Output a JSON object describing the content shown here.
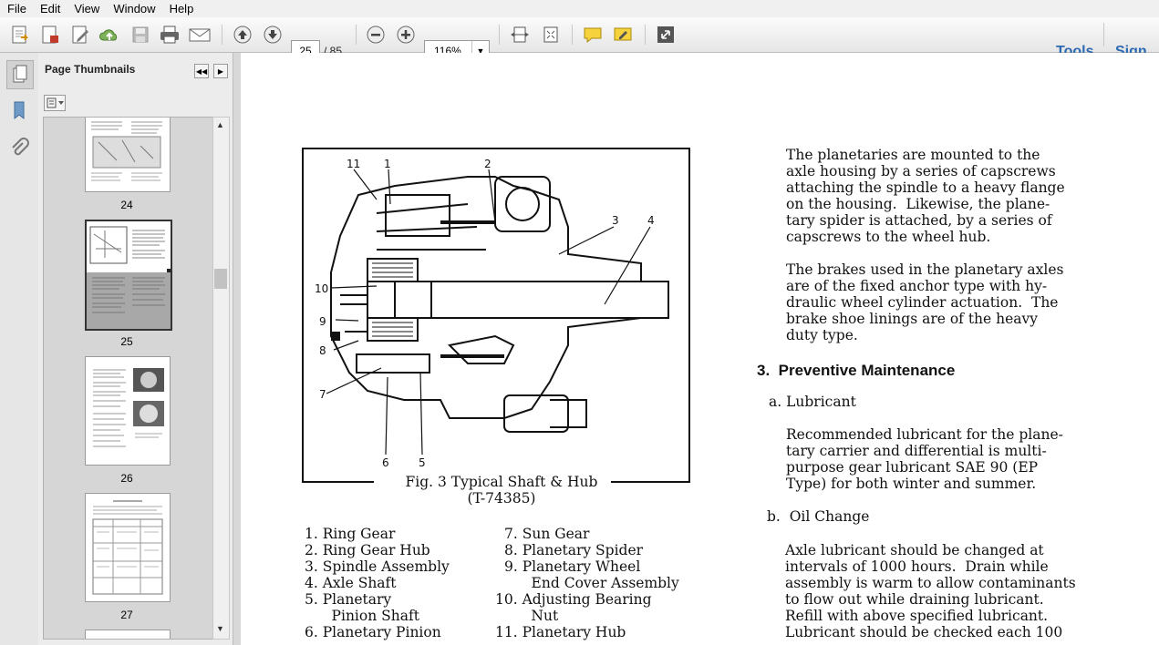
{
  "menu": [
    "File",
    "Edit",
    "View",
    "Window",
    "Help"
  ],
  "toolbar": {
    "page_current": "25",
    "page_total": "/ 85",
    "zoom": "116%",
    "tools_label": "Tools",
    "sign_label": "Sign"
  },
  "nav_panel": {
    "title": "Page Thumbnails",
    "pages": [
      "24",
      "25",
      "26",
      "27"
    ]
  },
  "figure": {
    "caption_line1": "Fig. 3 Typical Shaft & Hub",
    "caption_line2": "(T-74385)",
    "callouts": [
      "11",
      "1",
      "2",
      "3",
      "4",
      "10",
      "9",
      "8",
      "7",
      "6",
      "5"
    ]
  },
  "legend": {
    "left": [
      "1.  Ring Gear",
      "2.  Ring Gear Hub",
      "3.  Spindle Assembly",
      "4.  Axle Shaft",
      "5.  Planetary",
      "      Pinion Shaft",
      "6.  Planetary Pinion"
    ],
    "right": [
      "7.  Sun Gear",
      "8.  Planetary Spider",
      "9.  Planetary Wheel",
      "      End Cover Assembly",
      "10.  Adjusting Bearing",
      "        Nut",
      "11.  Planetary Hub"
    ]
  },
  "body": {
    "para1": [
      "The planetaries are mounted to the",
      "axle housing by a series of capscrews",
      "attaching the spindle to a heavy flange",
      "on the housing.  Likewise, the plane-",
      "tary spider is attached, by a series of",
      "capscrews to the wheel hub."
    ],
    "para2": [
      "The brakes used in the planetary axles",
      "are of the fixed anchor type with hy-",
      "draulic wheel cylinder actuation.  The",
      "brake shoe linings are of the heavy",
      "duty type."
    ],
    "section_heading": "3.  Preventive Maintenance",
    "sub_a": "a. Lubricant",
    "para3": [
      "Recommended lubricant for the plane-",
      "tary carrier and differential is multi-",
      "purpose gear lubricant SAE 90 (EP",
      "Type) for both winter and summer."
    ],
    "sub_b": "b.  Oil Change",
    "para4": [
      "Axle lubricant should be changed at",
      "intervals of 1000 hours.  Drain while",
      "assembly is warm to allow contaminants",
      "to flow out while draining lubricant.",
      "Refill with above specified lubricant.",
      "Lubricant should be checked each 100"
    ]
  }
}
